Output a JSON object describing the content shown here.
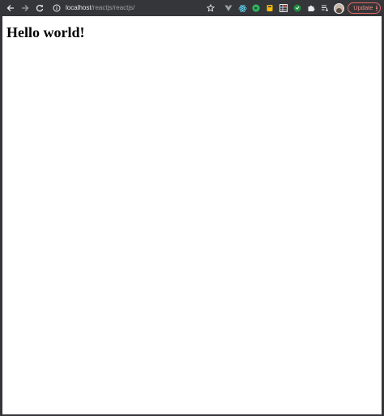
{
  "browser": {
    "url_host": "localhost",
    "url_path": "/reactjs/reactjs/",
    "update_label": "Update",
    "icons": {
      "back": "arrow-left-icon",
      "forward": "arrow-right-icon",
      "reload": "reload-icon",
      "site_info": "info-icon",
      "bookmark": "star-icon",
      "extensions": [
        "vue-devtools-icon",
        "react-devtools-icon",
        "evernote-icon",
        "color-picker-icon",
        "grid-icon",
        "green-ext-icon",
        "puzzle-icon",
        "reading-list-icon"
      ]
    },
    "colors": {
      "toolbar": "#35363a",
      "update_accent": "#f28b82"
    }
  },
  "page": {
    "heading": "Hello world!"
  }
}
